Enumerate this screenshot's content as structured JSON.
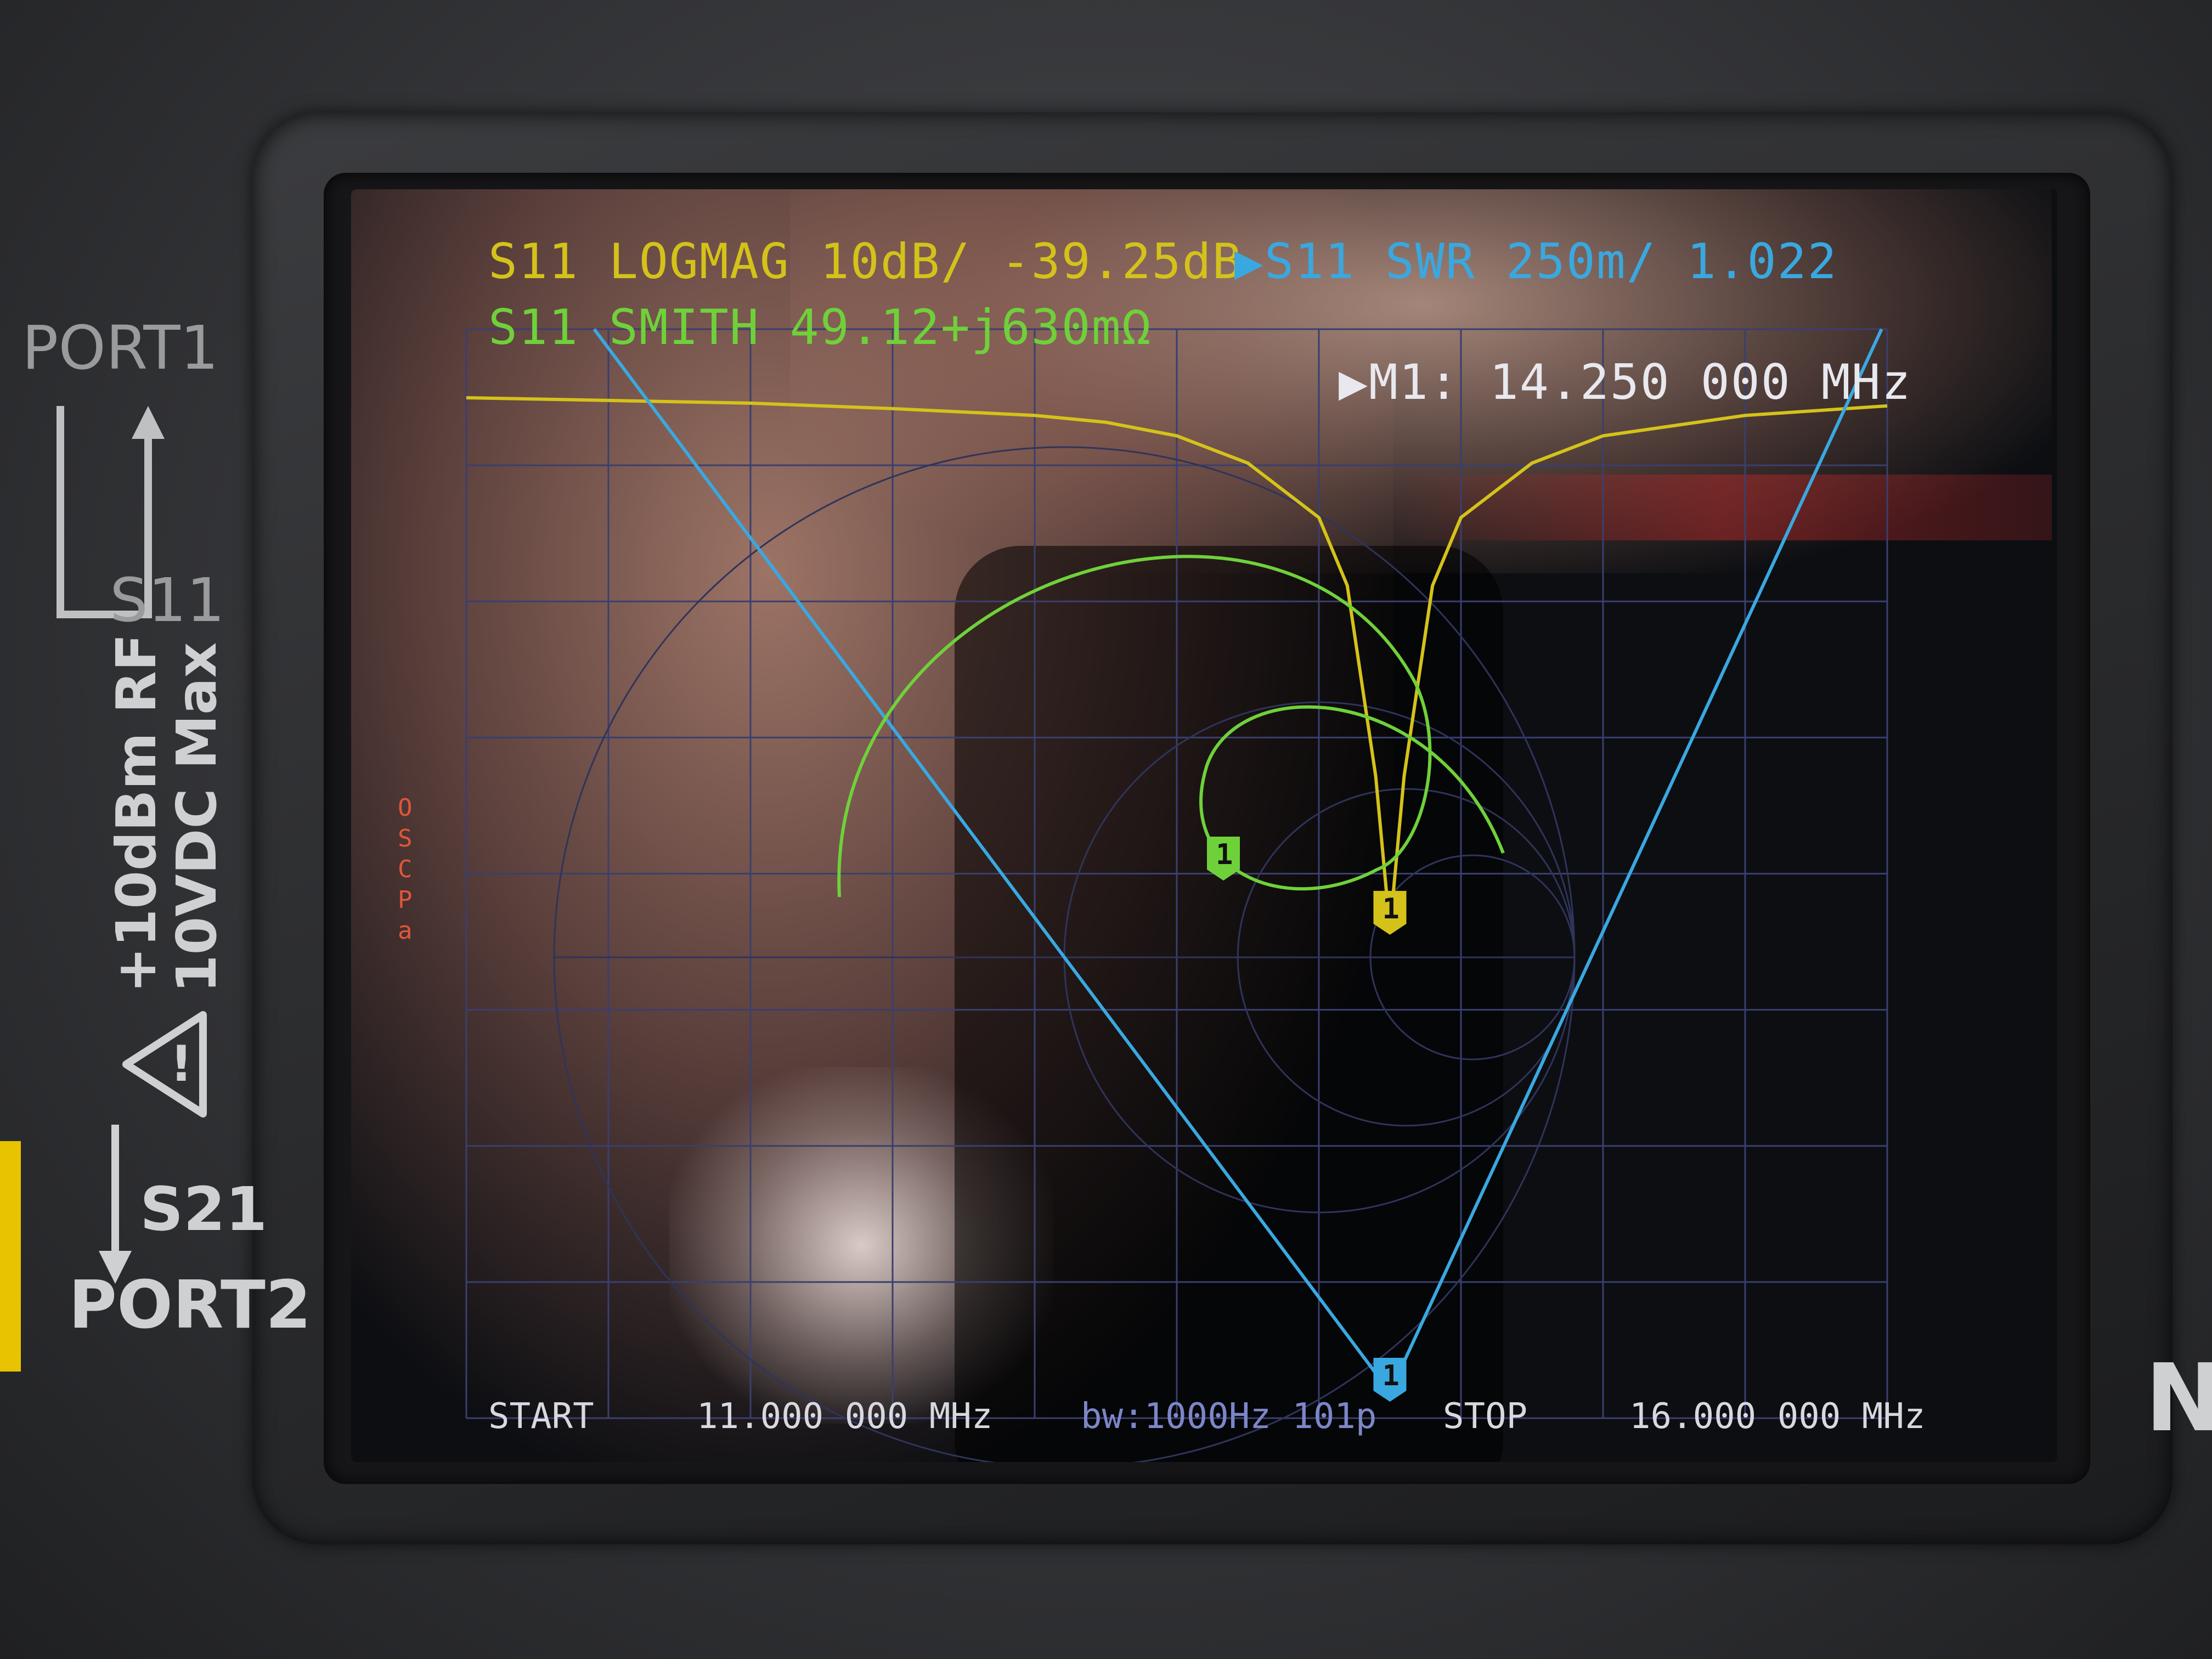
{
  "device": {
    "port1_label": "PORT1",
    "s11_label": "S11",
    "rf_warning_line1": "+10dBm RF",
    "rf_warning_line2": "10VDC Max",
    "s21_label": "S21",
    "port2_label": "PORT2",
    "brand_letter": "N"
  },
  "header": {
    "trace1": "S11 LOGMAG 10dB/ -39.25dB",
    "trace2": "▶S11 SWR 250m/ 1.022",
    "trace3": "S11 SMITH  49.12+j630mΩ",
    "marker": "▶M1: 14.250 000 MHz"
  },
  "footer": {
    "start_label": "START",
    "start_freq": "11.000 000 MHz",
    "bw": "bw:1000Hz 101p",
    "stop_label": "STOP",
    "stop_freq": "16.000 000 MHz"
  },
  "side_status": "OSCPa",
  "marker_label": "1",
  "colors": {
    "logmag": "#d4c21a",
    "swr": "#3aa8e0",
    "smith": "#6fd13a",
    "grid": "#3a3f6e",
    "status": "#e0563a"
  },
  "chart_data": {
    "type": "line",
    "x_start_mhz": 11.0,
    "x_stop_mhz": 16.0,
    "marker_freq_mhz": 14.25,
    "series": [
      {
        "name": "S11 LOGMAG",
        "x": [
          11.0,
          11.5,
          12.0,
          12.5,
          13.0,
          13.25,
          13.5,
          13.75,
          14.0,
          14.1,
          14.2,
          14.25,
          14.3,
          14.4,
          14.5,
          14.75,
          15.0,
          15.5,
          16.0
        ],
        "values": [
          -0.2,
          -0.4,
          -0.6,
          -1.0,
          -1.5,
          -2.0,
          -3.0,
          -5.0,
          -9.0,
          -14.0,
          -28.0,
          -39.25,
          -28.0,
          -14.0,
          -9.0,
          -5.0,
          -3.0,
          -1.5,
          -0.8
        ]
      },
      {
        "name": "S11 SWR",
        "x": [
          11.45,
          14.25,
          15.98
        ],
        "values": [
          8.5,
          1.022,
          8.7
        ]
      }
    ]
  }
}
